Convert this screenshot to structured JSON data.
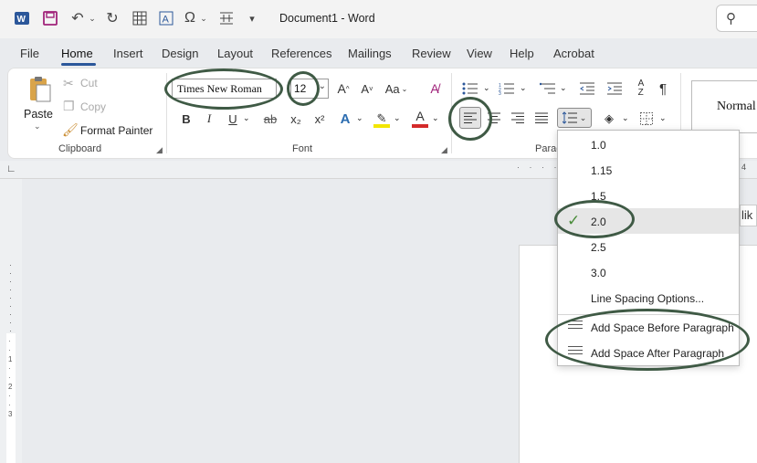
{
  "titlebar": {
    "title": "Document1  -  Word",
    "icons": [
      "word-app-icon",
      "save-icon",
      "undo-icon",
      "redo-icon",
      "table-icon",
      "text-box-icon",
      "symbol-icon",
      "spacing-icon",
      "customize-icon"
    ]
  },
  "tabs": [
    "File",
    "Home",
    "Insert",
    "Design",
    "Layout",
    "References",
    "Mailings",
    "Review",
    "View",
    "Help",
    "Acrobat"
  ],
  "clipboard": {
    "paste": "Paste",
    "cut": "Cut",
    "copy": "Copy",
    "format_painter": "Format Painter",
    "label": "Clipboard"
  },
  "font": {
    "family": "Times New Roman",
    "size": "12",
    "label": "Font",
    "bold": "B",
    "italic": "I",
    "underline": "U",
    "strike": "ab",
    "subscript": "x₂",
    "superscript": "x²",
    "grow": "A^",
    "shrink": "A˅",
    "case": "Aa"
  },
  "paragraph": {
    "label": "Parag",
    "pilcrow": "¶"
  },
  "styles": {
    "normal": "Normal"
  },
  "line_spacing_menu": {
    "items": [
      "1.0",
      "1.15",
      "1.5",
      "2.0",
      "2.5",
      "3.0"
    ],
    "selected": "2.0",
    "options": "Line Spacing Options...",
    "add_before": "Add Space Before Paragraph",
    "add_after": "Add Space After Paragraph"
  },
  "side_peek": "lik",
  "colors": {
    "accent": "#2b579a",
    "annotation": "#3f5a45",
    "check": "#4a8c3a"
  }
}
